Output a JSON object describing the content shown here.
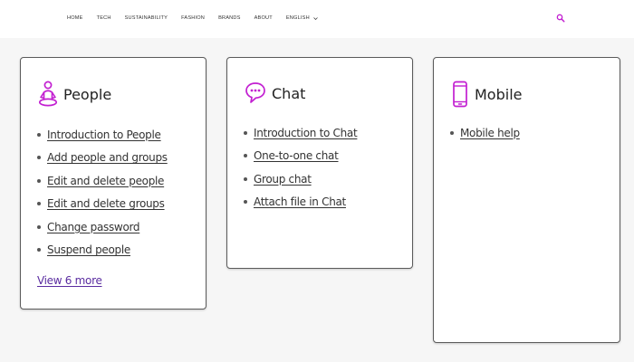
{
  "nav": {
    "items": [
      "HOME",
      "TECH",
      "SUSTAINABILITY",
      "FASHION",
      "BRANDS",
      "ABOUT"
    ],
    "language": "ENGLISH"
  },
  "accent_color": "#c21fd1",
  "cards": {
    "people": {
      "title": "People",
      "icon": "person-meditation-icon",
      "links": [
        "Introduction to People",
        "Add people and groups",
        "Edit and delete people",
        "Edit and delete groups",
        "Change password",
        "Suspend people"
      ],
      "more": "View 6 more"
    },
    "chat": {
      "title": "Chat",
      "icon": "chat-bubble-icon",
      "links": [
        "Introduction to Chat",
        "One-to-one chat",
        "Group chat",
        "Attach file in Chat"
      ]
    },
    "mobile": {
      "title": "Mobile",
      "icon": "mobile-phone-icon",
      "links": [
        "Mobile help"
      ]
    }
  }
}
